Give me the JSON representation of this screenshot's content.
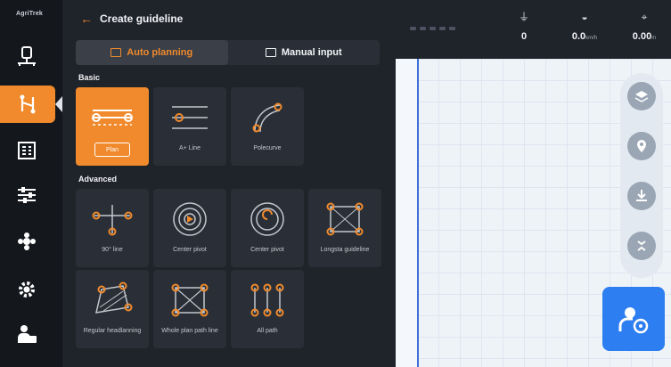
{
  "app": {
    "brand": "AgriTrek"
  },
  "rail": {
    "items": [
      {
        "name": "field-icon"
      },
      {
        "name": "guidance-icon",
        "active": true
      },
      {
        "name": "tasks-icon"
      },
      {
        "name": "settings-sliders-icon"
      },
      {
        "name": "drone-icon"
      },
      {
        "name": "gear-icon"
      },
      {
        "name": "operator-icon"
      }
    ]
  },
  "panel": {
    "title": "Create guideline",
    "tabs": [
      {
        "label": "Auto planning",
        "active": true
      },
      {
        "label": "Manual input",
        "active": false
      }
    ],
    "basic": {
      "title": "Basic",
      "cards": [
        {
          "label": "",
          "button": "Plan",
          "selected": true
        },
        {
          "label": "A+ Line"
        },
        {
          "label": "Polecurve"
        }
      ]
    },
    "advanced": {
      "title": "Advanced",
      "cards": [
        {
          "label": "90° line"
        },
        {
          "label": "Center pivot"
        },
        {
          "label": "Center pivot"
        },
        {
          "label": "Longsta guideline"
        },
        {
          "label": "Regular headlanning"
        },
        {
          "label": "Whole plan path line"
        },
        {
          "label": "All path"
        }
      ]
    }
  },
  "status": {
    "satellites": "0",
    "speed": "0.0",
    "speed_unit": "km/h",
    "accuracy": "0.00",
    "accuracy_unit": "m"
  },
  "colors": {
    "accent": "#f08a2c",
    "primary": "#2d7ef0",
    "panel": "#1f232a"
  }
}
